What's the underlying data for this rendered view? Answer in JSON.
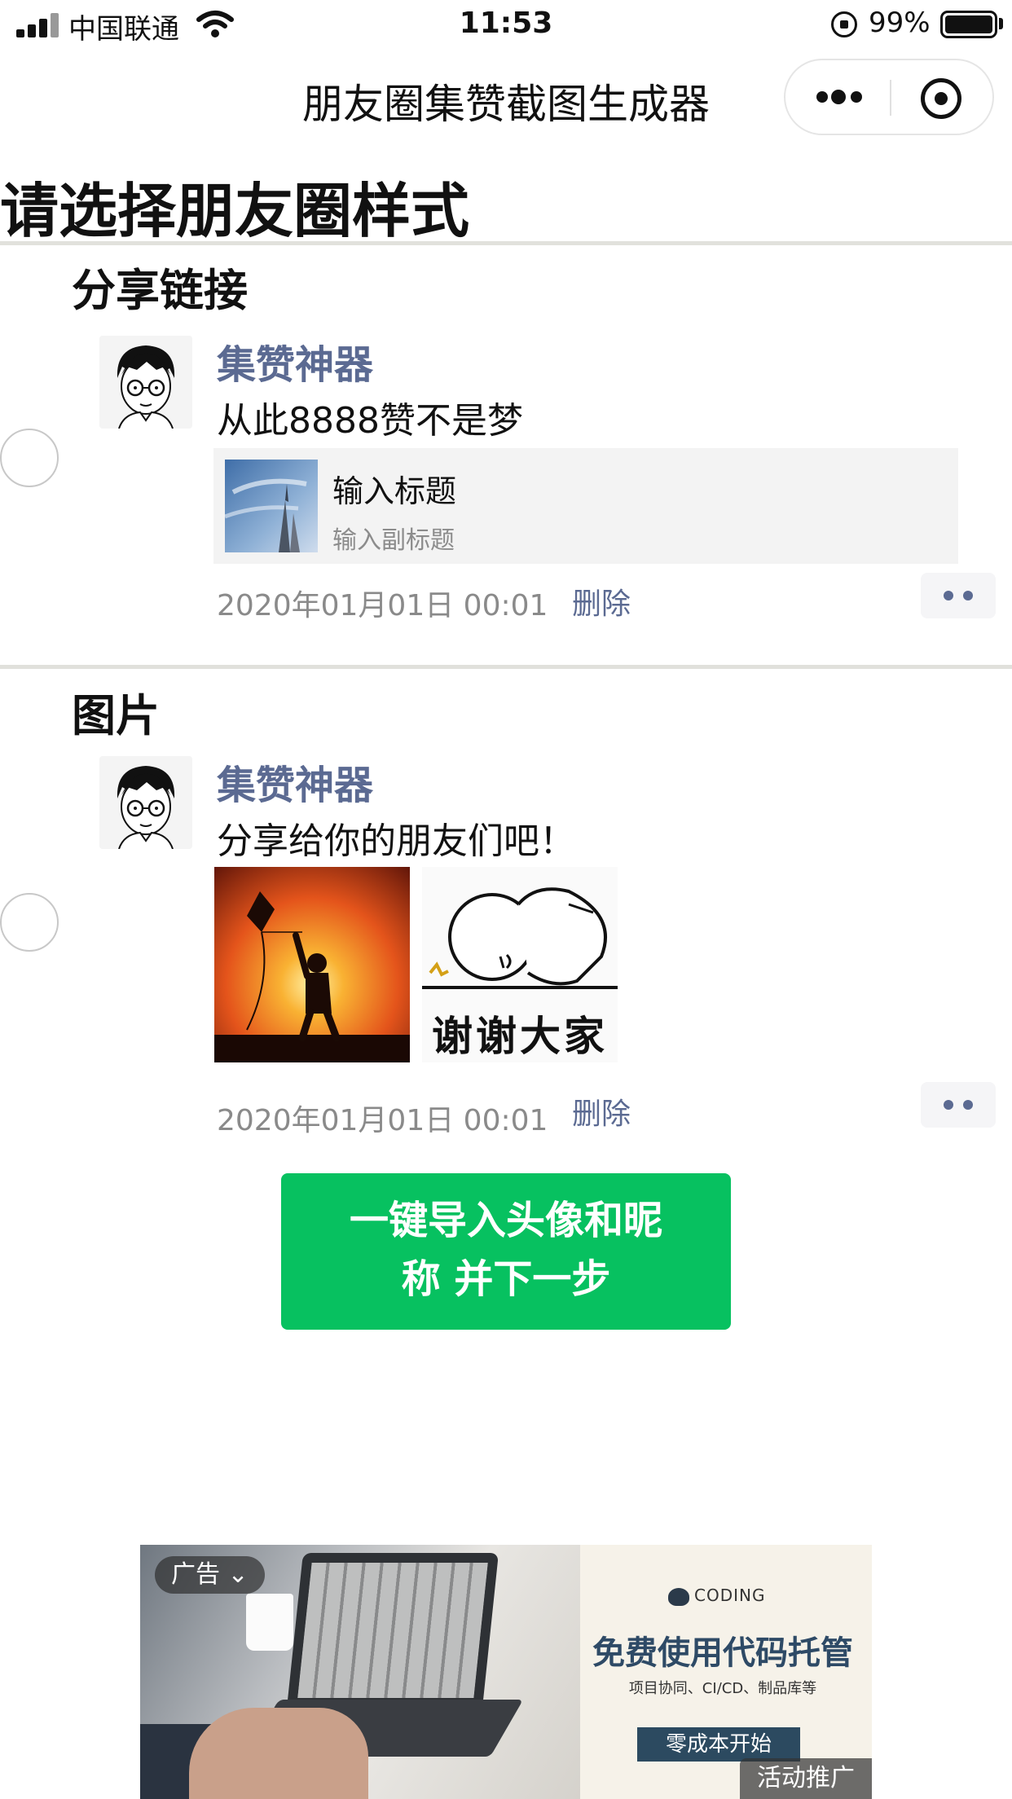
{
  "status_bar": {
    "carrier": "中国联通",
    "time": "11:53",
    "battery_percent": "99%",
    "signal_bars": 4,
    "icons": [
      "signal-icon",
      "wifi-icon",
      "orientation-lock-icon",
      "battery-icon"
    ]
  },
  "nav": {
    "title": "朋友圈集赞截图生成器",
    "icons": [
      "more-dots-icon",
      "close-target-icon"
    ]
  },
  "page_title": "请选择朋友圈样式",
  "styles": [
    {
      "label": "分享链接",
      "nickname": "集赞神器",
      "text": "从此8888赞不是梦",
      "link_title": "输入标题",
      "link_subtitle": "输入副标题",
      "time": "2020年01月01日 00:01",
      "delete_label": "删除",
      "selected": false
    },
    {
      "label": "图片",
      "nickname": "集赞神器",
      "text": "分享给你的朋友们吧！",
      "images": [
        "kite-sunset-photo",
        "thanks-sticker"
      ],
      "sticker_text": "谢谢大家",
      "time": "2020年01月01日 00:01",
      "delete_label": "删除",
      "selected": false
    }
  ],
  "cta": {
    "line1": "一键导入头像和昵",
    "line2": "称 并下一步",
    "color": "#07c160"
  },
  "ad": {
    "tag": "广告",
    "brand": "CODING",
    "headline": "免费使用代码托管",
    "subline": "项目协同、CI/CD、制品库等",
    "button": "零成本开始",
    "promo": "活动推广"
  },
  "colors": {
    "nickname": "#5b6a92",
    "primary_green": "#07c160",
    "divider": "#e1e1dc"
  }
}
